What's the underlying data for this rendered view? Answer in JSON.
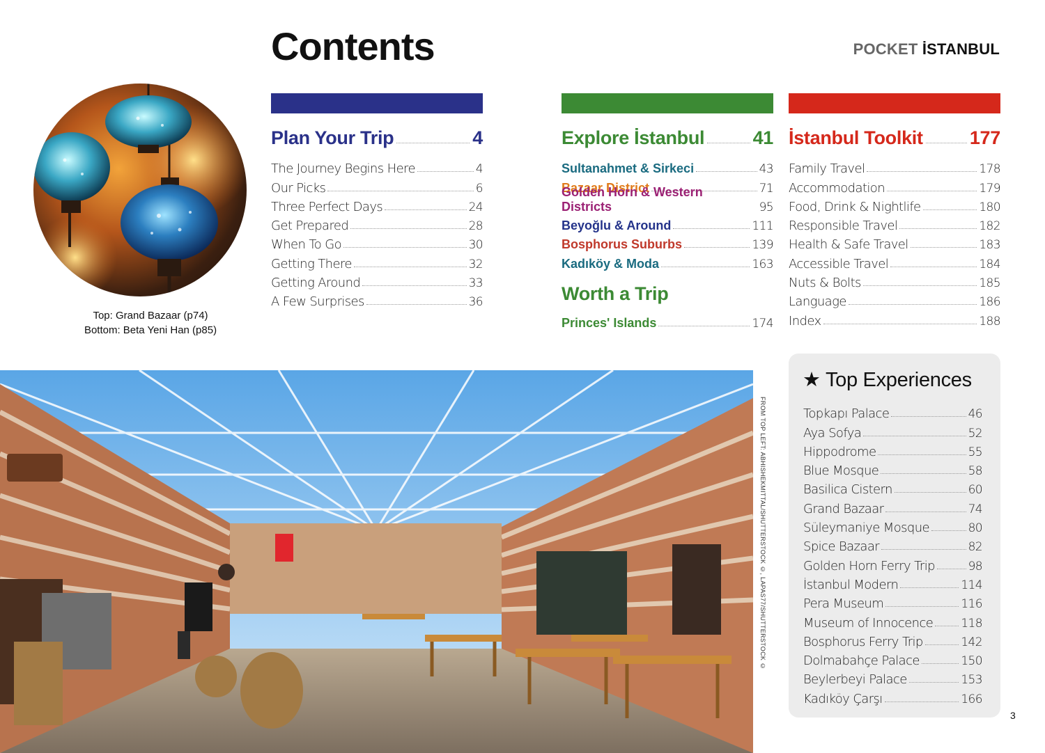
{
  "header": {
    "title": "Contents",
    "brand_pocket": "POCKET",
    "brand_city": "İSTANBUL"
  },
  "caption": {
    "line1": "Top: Grand Bazaar (p74)",
    "line2": "Bottom: Beta Yeni Han (p85)"
  },
  "colors": {
    "plan": "#2a3189",
    "explore": "#3c8a34",
    "toolkit": "#d5281b",
    "sultanahmet": "#1a6b80",
    "bazaar": "#e07b1a",
    "golden_horn": "#9b2174",
    "beyoglu": "#24338a",
    "bosphorus": "#c0392b",
    "kadikoy": "#1a6b80",
    "worth": "#3c8a34"
  },
  "plan": {
    "title": "Plan Your Trip",
    "page": "4",
    "items": [
      {
        "label": "The Journey Begins Here",
        "page": "4"
      },
      {
        "label": "Our Picks",
        "page": "6"
      },
      {
        "label": "Three Perfect Days",
        "page": "24"
      },
      {
        "label": "Get Prepared",
        "page": "28"
      },
      {
        "label": "When To Go",
        "page": "30"
      },
      {
        "label": "Getting There",
        "page": "32"
      },
      {
        "label": "Getting Around",
        "page": "33"
      },
      {
        "label": "A Few Surprises",
        "page": "36"
      }
    ]
  },
  "explore": {
    "title": "Explore İstanbul",
    "page": "41",
    "items": [
      {
        "label": "Sultanahmet & Sirkeci",
        "page": "43"
      },
      {
        "label": "Bazaar District",
        "page": "71"
      },
      {
        "label": "Golden Horn & Western Districts",
        "page": "95"
      },
      {
        "label": "Beyoğlu & Around",
        "page": "111"
      },
      {
        "label": "Bosphorus Suburbs",
        "page": "139"
      },
      {
        "label": "Kadıköy & Moda",
        "page": "163"
      }
    ],
    "worth_title": "Worth a Trip",
    "worth_items": [
      {
        "label": "Princes' Islands",
        "page": "174"
      }
    ]
  },
  "toolkit": {
    "title": "İstanbul Toolkit",
    "page": "177",
    "items": [
      {
        "label": "Family Travel",
        "page": "178"
      },
      {
        "label": "Accommodation",
        "page": "179"
      },
      {
        "label": "Food, Drink & Nightlife",
        "page": "180"
      },
      {
        "label": "Responsible Travel",
        "page": "182"
      },
      {
        "label": "Health & Safe Travel",
        "page": "183"
      },
      {
        "label": "Accessible Travel",
        "page": "184"
      },
      {
        "label": "Nuts & Bolts",
        "page": "185"
      },
      {
        "label": "Language",
        "page": "186"
      },
      {
        "label": "Index",
        "page": "188"
      }
    ]
  },
  "top_experiences": {
    "star": "★",
    "title": "Top Experiences",
    "items": [
      {
        "label": "Topkapı Palace",
        "page": "46"
      },
      {
        "label": "Aya Sofya",
        "page": "52"
      },
      {
        "label": "Hippodrome",
        "page": "55"
      },
      {
        "label": "Blue Mosque",
        "page": "58"
      },
      {
        "label": "Basilica Cistern",
        "page": "60"
      },
      {
        "label": "Grand Bazaar",
        "page": "74"
      },
      {
        "label": "Süleymaniye Mosque",
        "page": "80"
      },
      {
        "label": "Spice Bazaar",
        "page": "82"
      },
      {
        "label": "Golden Horn Ferry Trip",
        "page": "98"
      },
      {
        "label": "İstanbul Modern",
        "page": "114"
      },
      {
        "label": "Pera Museum",
        "page": "116"
      },
      {
        "label": "Museum of Innocence",
        "page": "118"
      },
      {
        "label": "Bosphorus Ferry Trip",
        "page": "142"
      },
      {
        "label": "Dolmabahçe Palace",
        "page": "150"
      },
      {
        "label": "Beylerbeyi Palace",
        "page": "153"
      },
      {
        "label": "Kadıköy Çarşı",
        "page": "166"
      }
    ]
  },
  "photo_credit": "FROM TOP LEFT: ABHISHEKMITTAL/SHUTTERSTOCK ©, LAPAS77/SHUTTERSTOCK ©",
  "page_number": "3"
}
